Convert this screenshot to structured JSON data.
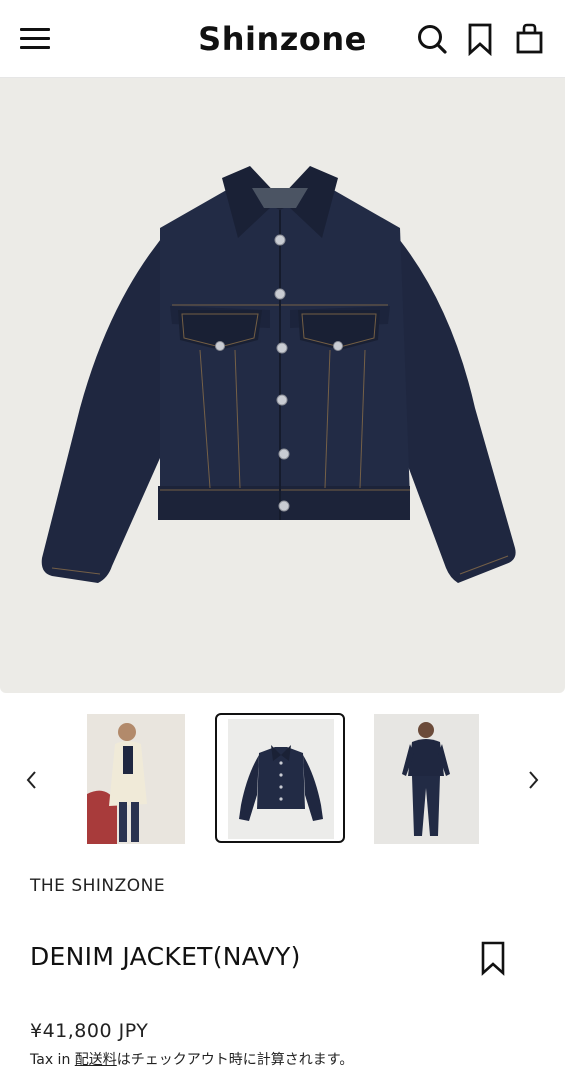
{
  "header": {
    "logo": "Shinzone",
    "icons": [
      "menu-icon",
      "search-icon",
      "bookmark-icon",
      "shopping-bag-icon"
    ]
  },
  "gallery": {
    "thumbnails": [
      "thumbnail-model-white-coat",
      "thumbnail-jacket-flat",
      "thumbnail-model-denim-setup"
    ],
    "selected_index": 1,
    "prev_icon": "chevron-left-icon",
    "next_icon": "chevron-right-icon"
  },
  "product": {
    "brand": "THE SHINZONE",
    "title": "DENIM JACKET(NAVY)",
    "price": "¥41,800 JPY",
    "tax_prefix": "Tax in ",
    "shipping_link": "配送料",
    "tax_suffix": "はチェックアウト時に計算されます。"
  },
  "colors": {
    "background": "#ffffff",
    "hero_background": "#ecebe7",
    "denim": "#1f2740",
    "text": "#111111"
  }
}
